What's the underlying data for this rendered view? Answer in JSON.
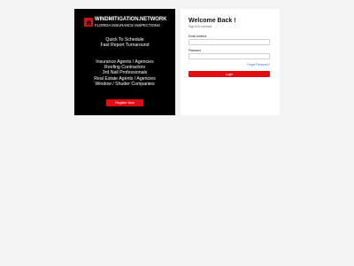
{
  "brand": {
    "name": "WINDMITIGATION.NETWORK",
    "tagline": "FLORIDA INSURANCE INSPECTIONS",
    "logo_icon": "house-icon",
    "accent_color": "#e00d14"
  },
  "promo": {
    "taglines": [
      "Quick To Schedule",
      "Fast Report Turnaround"
    ],
    "audience": [
      "Insurance Agents / Agencies",
      "Roofing Contractors",
      "3rd Nail Professionals",
      "Real Estate Agents / Agencies",
      "Window / Shutter Companies"
    ],
    "register_label": "Register Now"
  },
  "login": {
    "title": "Welcome Back !",
    "subtitle": "Sign in to continue.",
    "email_label": "Email Address",
    "email_value": "",
    "password_label": "Password",
    "password_value": "",
    "forgot_label": "Forgot Password?",
    "login_label": "Login"
  }
}
